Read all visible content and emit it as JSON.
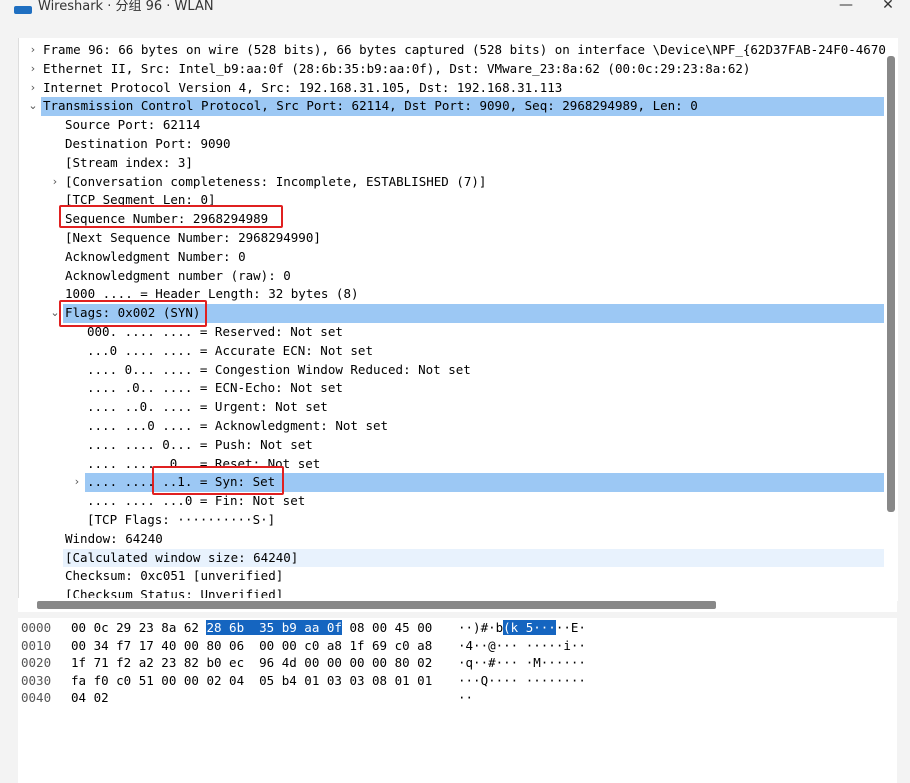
{
  "window": {
    "title": "Wireshark · 分组 96 · WLAN",
    "minimize": "—",
    "close": "✕"
  },
  "tree": [
    {
      "indent": 0,
      "arrow": "›",
      "text": "Frame 96: 66 bytes on wire (528 bits), 66 bytes captured (528 bits) on interface \\Device\\NPF_{62D37FAB-24F0-4670",
      "state": ""
    },
    {
      "indent": 0,
      "arrow": "›",
      "text": "Ethernet II, Src: Intel_b9:aa:0f (28:6b:35:b9:aa:0f), Dst: VMware_23:8a:62 (00:0c:29:23:8a:62)",
      "state": ""
    },
    {
      "indent": 0,
      "arrow": "›",
      "text": "Internet Protocol Version 4, Src: 192.168.31.105, Dst: 192.168.31.113",
      "state": ""
    },
    {
      "indent": 0,
      "arrow": "⌄",
      "text": "Transmission Control Protocol, Src Port: 62114, Dst Port: 9090, Seq: 2968294989, Len: 0",
      "state": "sel"
    },
    {
      "indent": 1,
      "arrow": "",
      "text": "Source Port: 62114",
      "state": ""
    },
    {
      "indent": 1,
      "arrow": "",
      "text": "Destination Port: 9090",
      "state": ""
    },
    {
      "indent": 1,
      "arrow": "",
      "text": "[Stream index: 3]",
      "state": ""
    },
    {
      "indent": 1,
      "arrow": "›",
      "text": "[Conversation completeness: Incomplete, ESTABLISHED (7)]",
      "state": ""
    },
    {
      "indent": 1,
      "arrow": "",
      "text": "[TCP Segment Len: 0]",
      "state": ""
    },
    {
      "indent": 1,
      "arrow": "",
      "text": "Sequence Number: 2968294989",
      "state": ""
    },
    {
      "indent": 1,
      "arrow": "",
      "text": "[Next Sequence Number: 2968294990]",
      "state": ""
    },
    {
      "indent": 1,
      "arrow": "",
      "text": "Acknowledgment Number: 0",
      "state": ""
    },
    {
      "indent": 1,
      "arrow": "",
      "text": "Acknowledgment number (raw): 0",
      "state": ""
    },
    {
      "indent": 1,
      "arrow": "",
      "text": "1000 .... = Header Length: 32 bytes (8)",
      "state": ""
    },
    {
      "indent": 1,
      "arrow": "⌄",
      "text": "Flags: 0x002 (SYN)",
      "state": "sel"
    },
    {
      "indent": 2,
      "arrow": "",
      "text": "000. .... .... = Reserved: Not set",
      "state": ""
    },
    {
      "indent": 2,
      "arrow": "",
      "text": "...0 .... .... = Accurate ECN: Not set",
      "state": ""
    },
    {
      "indent": 2,
      "arrow": "",
      "text": ".... 0... .... = Congestion Window Reduced: Not set",
      "state": ""
    },
    {
      "indent": 2,
      "arrow": "",
      "text": ".... .0.. .... = ECN-Echo: Not set",
      "state": ""
    },
    {
      "indent": 2,
      "arrow": "",
      "text": ".... ..0. .... = Urgent: Not set",
      "state": ""
    },
    {
      "indent": 2,
      "arrow": "",
      "text": ".... ...0 .... = Acknowledgment: Not set",
      "state": ""
    },
    {
      "indent": 2,
      "arrow": "",
      "text": ".... .... 0... = Push: Not set",
      "state": ""
    },
    {
      "indent": 2,
      "arrow": "",
      "text": ".... .... .0.. = Reset: Not set",
      "state": ""
    },
    {
      "indent": 2,
      "arrow": "›",
      "text": ".... .... ..1. = Syn: Set",
      "state": "sel"
    },
    {
      "indent": 2,
      "arrow": "",
      "text": ".... .... ...0 = Fin: Not set",
      "state": ""
    },
    {
      "indent": 2,
      "arrow": "",
      "text": "[TCP Flags: ··········S·]",
      "state": ""
    },
    {
      "indent": 1,
      "arrow": "",
      "text": "Window: 64240",
      "state": ""
    },
    {
      "indent": 1,
      "arrow": "",
      "text": "[Calculated window size: 64240]",
      "state": "hl"
    },
    {
      "indent": 1,
      "arrow": "",
      "text": "Checksum: 0xc051 [unverified]",
      "state": ""
    },
    {
      "indent": 1,
      "arrow": "",
      "text": "[Checksum Status: Unverified]",
      "state": ""
    }
  ],
  "hex": [
    {
      "offset": "0000",
      "hex_pre": "00 0c 29 23 8a 62 ",
      "hex_hl": "28 6b  35 b9 aa 0f",
      "hex_post": " 08 00 45 00",
      "asc_pre": "··)#·b",
      "asc_hl": "(k 5···",
      "asc_post": "··E·"
    },
    {
      "offset": "0010",
      "hex_pre": "00 34 f7 17 40 00 80 06  00 00 c0 a8 1f 69 c0 a8",
      "hex_hl": "",
      "hex_post": "",
      "asc_pre": "·4··@··· ·····i··",
      "asc_hl": "",
      "asc_post": ""
    },
    {
      "offset": "0020",
      "hex_pre": "1f 71 f2 a2 23 82 b0 ec  96 4d 00 00 00 00 80 02",
      "hex_hl": "",
      "hex_post": "",
      "asc_pre": "·q··#··· ·M······",
      "asc_hl": "",
      "asc_post": ""
    },
    {
      "offset": "0030",
      "hex_pre": "fa f0 c0 51 00 00 02 04  05 b4 01 03 03 08 01 01",
      "hex_hl": "",
      "hex_post": "",
      "asc_pre": "···Q···· ········",
      "asc_hl": "",
      "asc_post": ""
    },
    {
      "offset": "0040",
      "hex_pre": "04 02",
      "hex_hl": "",
      "hex_post": "",
      "asc_pre": "··",
      "asc_hl": "",
      "asc_post": ""
    }
  ],
  "annotation_color": "#e02020",
  "selection_color": "#9cc8f4"
}
